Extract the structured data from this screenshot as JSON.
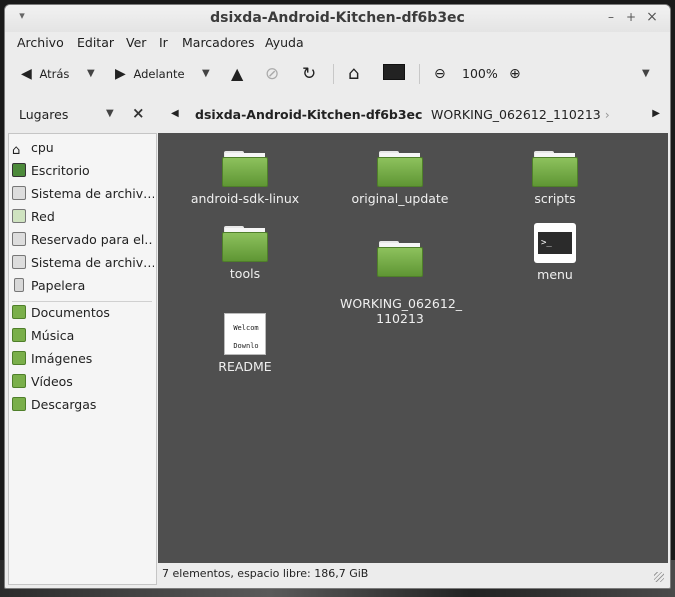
{
  "window": {
    "title": "dsixda-Android-Kitchen-df6b3ec",
    "controls": {
      "minimize": "–",
      "maximize": "+",
      "close": "×"
    }
  },
  "menubar": [
    "Archivo",
    "Editar",
    "Ver",
    "Ir",
    "Marcadores",
    "Ayuda"
  ],
  "toolbar": {
    "back_label": "Atrás",
    "forward_label": "Adelante",
    "zoom_level": "100%"
  },
  "sidebar": {
    "title": "Lugares",
    "group1": [
      {
        "label": "cpu",
        "icon": "home-icon"
      },
      {
        "label": "Escritorio",
        "icon": "desktop-icon"
      },
      {
        "label": "Sistema de archiv…",
        "icon": "drive-icon"
      },
      {
        "label": "Red",
        "icon": "network-icon"
      },
      {
        "label": "Reservado para el…",
        "icon": "drive-icon"
      },
      {
        "label": "Sistema de archiv…",
        "icon": "drive-icon"
      },
      {
        "label": "Papelera",
        "icon": "trash-icon"
      }
    ],
    "group2": [
      {
        "label": "Documentos",
        "icon": "folder-documents-icon"
      },
      {
        "label": "Música",
        "icon": "folder-music-icon"
      },
      {
        "label": "Imágenes",
        "icon": "folder-pictures-icon"
      },
      {
        "label": "Vídeos",
        "icon": "folder-videos-icon"
      },
      {
        "label": "Descargas",
        "icon": "folder-downloads-icon"
      }
    ]
  },
  "pathbar": {
    "current": "dsixda-Android-Kitchen-df6b3ec",
    "next": "WORKING_062612_110213"
  },
  "files": [
    {
      "name": "android-sdk-linux",
      "type": "folder"
    },
    {
      "name": "original_update",
      "type": "folder"
    },
    {
      "name": "scripts",
      "type": "folder"
    },
    {
      "name": "tools",
      "type": "folder"
    },
    {
      "name": "WORKING_062612_\n110213",
      "type": "folder"
    },
    {
      "name": "menu",
      "type": "executable",
      "preview": ">_"
    },
    {
      "name": "README",
      "type": "text",
      "preview": [
        "Welcom",
        "Downlo"
      ]
    }
  ],
  "status": "7 elementos, espacio libre: 186,7 GiB",
  "colors": {
    "content_bg": "#4f4f4f",
    "folder_green": "#7aaf4a"
  }
}
